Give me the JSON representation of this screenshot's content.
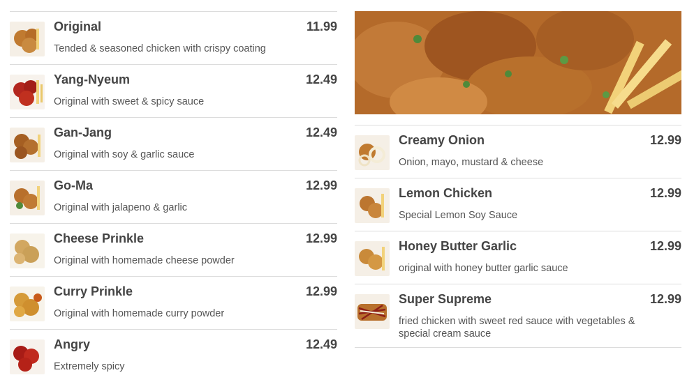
{
  "menu": {
    "left_items": [
      {
        "name": "Original",
        "price": "11.99",
        "desc": "Tended & seasoned chicken with crispy coating",
        "thumb_icon": "fried-chicken-plain-icon"
      },
      {
        "name": "Yang-Nyeum",
        "price": "12.49",
        "desc": "Original with sweet & spicy sauce",
        "thumb_icon": "fried-chicken-red-sauce-icon"
      },
      {
        "name": "Gan-Jang",
        "price": "12.49",
        "desc": "Original with soy & garlic sauce",
        "thumb_icon": "fried-chicken-soy-icon"
      },
      {
        "name": "Go-Ma",
        "price": "12.99",
        "desc": "Original with jalapeno & garlic",
        "thumb_icon": "fried-chicken-jalapeno-icon"
      },
      {
        "name": "Cheese Prinkle",
        "price": "12.99",
        "desc": "Original with homemade cheese powder",
        "thumb_icon": "fried-chicken-cheese-icon"
      },
      {
        "name": "Curry Prinkle",
        "price": "12.99",
        "desc": "Original with homemade curry powder",
        "thumb_icon": "fried-chicken-curry-icon"
      },
      {
        "name": "Angry",
        "price": "12.49",
        "desc": "Extremely spicy",
        "thumb_icon": "fried-chicken-spicy-icon"
      }
    ],
    "right_items": [
      {
        "name": "Creamy Onion",
        "price": "12.99",
        "desc": "Onion, mayo, mustard & cheese",
        "thumb_icon": "fried-chicken-onion-icon"
      },
      {
        "name": "Lemon Chicken",
        "price": "12.99",
        "desc": "Special Lemon Soy Sauce",
        "thumb_icon": "fried-chicken-lemon-icon"
      },
      {
        "name": "Honey Butter Garlic",
        "price": "12.99",
        "desc": "original with honey butter garlic sauce",
        "thumb_icon": "fried-chicken-honey-icon"
      },
      {
        "name": "Super Supreme",
        "price": "12.99",
        "desc": "fried chicken with sweet red sauce with vegetables & special cream sauce",
        "thumb_icon": "fried-chicken-supreme-icon"
      }
    ]
  },
  "colors": {
    "text": "#444444",
    "divider": "#dcdcdc",
    "chicken": "#b8702c",
    "sauce_red": "#b3261e",
    "fries": "#f2d27a",
    "herb": "#4f8a3a"
  }
}
